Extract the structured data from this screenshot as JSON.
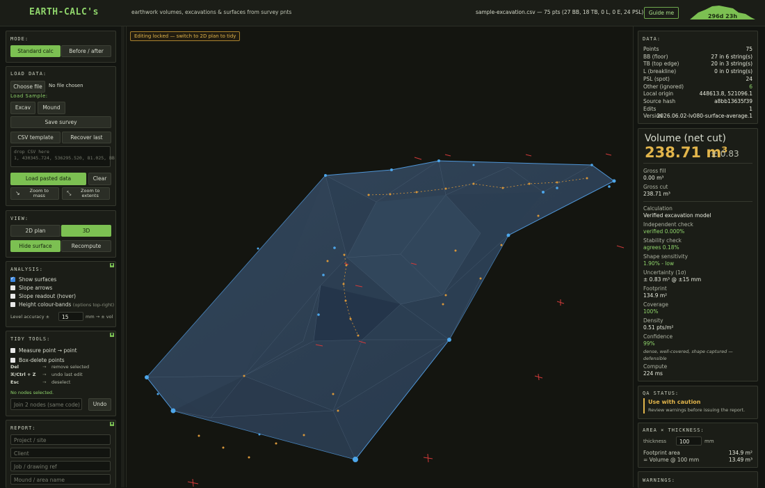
{
  "app": {
    "title": "EARTH-CALC's",
    "tagline": "earthwork volumes, excavations & surfaces from survey pnts",
    "file_info": "sample-excavation.csv — 75 pts (27 BB, 18 TB, 0 L, 0 E, 24 PSL)",
    "guide_label": "Guide me",
    "counter": "296d 23h"
  },
  "mode": {
    "header": "MODE:",
    "buttons": [
      "Standard calc",
      "Before / after"
    ]
  },
  "load": {
    "header": "LOAD DATA:",
    "choose_file": "Choose file",
    "no_file": "No file chosen",
    "sample_header": "Load Sample:",
    "samples": [
      "Excav",
      "Mound"
    ],
    "save_survey": "Save survey",
    "csv_template": "CSV template",
    "recover_last": "Recover last",
    "paste_placeholder": "drop CSV here\n1, 430345.724, 536295.520, 81.025, BB",
    "load_pasted": "Load pasted data",
    "clear": "Clear",
    "zoom_mass": "Zoom to\nmass",
    "zoom_extents": "Zoom to\nextents"
  },
  "view": {
    "header": "VIEW:",
    "buttons": [
      "2D plan",
      "3D"
    ],
    "hide_surface": "Hide surface",
    "recompute": "Recompute"
  },
  "analysis": {
    "header": "ANALYSIS:",
    "options": [
      {
        "label": "Show surfaces",
        "checked": true,
        "note": ""
      },
      {
        "label": "Slope arrows",
        "checked": false,
        "note": ""
      },
      {
        "label": "Slope readout (hover)",
        "checked": false,
        "note": ""
      },
      {
        "label": "Height colour-bands",
        "checked": false,
        "note": "(options top-right)"
      }
    ],
    "level_label": "Level accuracy ±",
    "level_value": "15",
    "level_unit": "mm → ± vol"
  },
  "tidy": {
    "header": "TIDY TOOLS:",
    "options": [
      "Measure point → point",
      "Box-delete points"
    ],
    "shortcuts": [
      {
        "key": "Del",
        "action": "remove selected"
      },
      {
        "key": "⌘/Ctrl + Z",
        "action": "undo last edit"
      },
      {
        "key": "Esc",
        "action": "deselect"
      }
    ],
    "status": "No nodes selected.",
    "join_placeholder": "Join 2 nodes (same code)",
    "undo": "Undo"
  },
  "report": {
    "header": "REPORT:",
    "fields": [
      "Project / site",
      "Client",
      "Job / drawing ref",
      "Mound / area name"
    ]
  },
  "viewport": {
    "locked_notice": "Editing locked — switch to 2D plan to tidy"
  },
  "data_panel": {
    "header": "DATA:",
    "rows": [
      {
        "label": "Points",
        "value": "75"
      },
      {
        "label": "BB (floor)",
        "value": "27 in 6 string(s)"
      },
      {
        "label": "TB (top edge)",
        "value": "20 in 3 string(s)"
      },
      {
        "label": "L (breakline)",
        "value": "0 in 0 string(s)"
      },
      {
        "label": "PSL (spot)",
        "value": "24"
      },
      {
        "label": "Other (ignored)",
        "value": "6"
      },
      {
        "label": "Local origin",
        "value": "448613.8, 521096.1"
      },
      {
        "label": "Source hash",
        "value": "a8bb13635f39"
      },
      {
        "label": "Edits",
        "value": "1"
      },
      {
        "label": "Version",
        "value": "2026.06.02-lv080-surface-average.1"
      }
    ]
  },
  "volume": {
    "title": "Volume (net cut)",
    "value": "238.71 m³",
    "uncertainty": "± 0.83",
    "gross_fill_label": "Gross fill",
    "gross_fill": "0.00 m³",
    "gross_cut_label": "Gross cut",
    "gross_cut": "238.71 m³",
    "calc_label": "Calculation",
    "calc_value": "Verified excavation model",
    "indep_label": "Independent check",
    "indep_value": "verified 0.000%",
    "stab_label": "Stability check",
    "stab_value": "agrees 0.18%",
    "shape_label": "Shape sensitivity",
    "shape_value": "1.90% - low",
    "unc_label": "Uncertainty (1σ)",
    "unc_value": "± 0.83 m³ @ ±15 mm",
    "foot_label": "Footprint",
    "foot_value": "134.9 m²",
    "cov_label": "Coverage",
    "cov_value": "100%",
    "dens_label": "Density",
    "dens_value": "0.51 pts/m²",
    "conf_label": "Confidence",
    "conf_value": "99%",
    "conf_note": "dense, well-covered, shape captured — defensible",
    "compute_label": "Compute",
    "compute_value": "224 ms"
  },
  "qa": {
    "header": "QA STATUS:",
    "title": "Use with caution",
    "note": "Review warnings before issuing the report."
  },
  "area": {
    "header": "AREA × THICKNESS:",
    "thickness_label": "thickness",
    "thickness_value": "100",
    "thickness_unit": "mm",
    "foot_label": "Footprint area",
    "foot_value": "134.9 m²",
    "vol_label": "= Volume @ 100 mm",
    "vol_value": "13.49 m³"
  },
  "warnings": {
    "header": "WARNINGS:"
  },
  "colors": {
    "accent": "#7cc052",
    "amber": "#e2b54b",
    "mesh_edge": "#4f96d8",
    "mesh_fill": "#2a3a4c",
    "marker": "#d23a3a",
    "spot": "#d9973a"
  }
}
